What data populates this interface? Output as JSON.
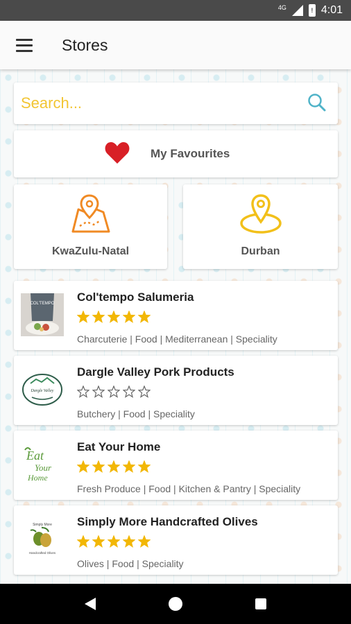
{
  "status_bar": {
    "network": "4G",
    "time": "4:01"
  },
  "app_bar": {
    "title": "Stores"
  },
  "search": {
    "placeholder": "Search..."
  },
  "favourites": {
    "label": "My Favourites"
  },
  "locations": [
    {
      "label": "KwaZulu-Natal",
      "icon": "map-pin-route-icon",
      "color": "#f08a24"
    },
    {
      "label": "Durban",
      "icon": "map-pin-circle-icon",
      "color": "#f2c01a"
    }
  ],
  "stores": [
    {
      "name": "Col'tempo Salumeria",
      "rating": 5,
      "tags": "Charcuterie | Food | Mediterranean | Speciality"
    },
    {
      "name": "Dargle Valley Pork Products",
      "rating": 0,
      "tags": "Butchery | Food | Speciality"
    },
    {
      "name": "Eat Your Home",
      "rating": 5,
      "tags": "Fresh Produce | Food | Kitchen & Pantry | Speciality"
    },
    {
      "name": "Simply More Handcrafted Olives",
      "rating": 5,
      "tags": "Olives | Food | Speciality"
    }
  ],
  "colors": {
    "accent": "#f2b705",
    "heart": "#d81f26",
    "search_icon": "#4fb3c8",
    "star": "#f2b705"
  }
}
